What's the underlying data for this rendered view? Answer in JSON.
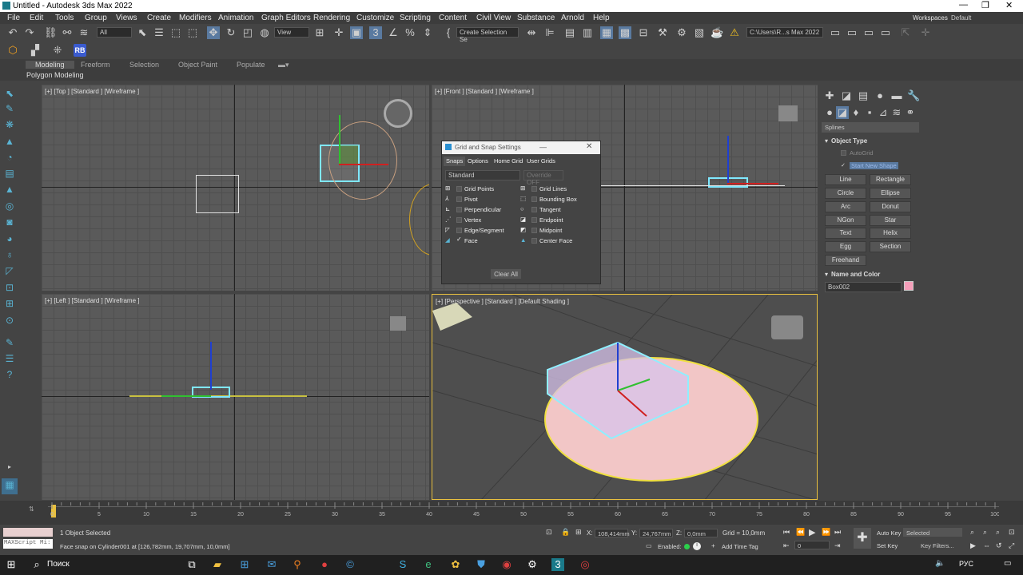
{
  "window": {
    "title": "Untitled - Autodesk 3ds Max 2022"
  },
  "menu": [
    "File",
    "Edit",
    "Tools",
    "Group",
    "Views",
    "Create",
    "Modifiers",
    "Animation",
    "Graph Editors",
    "Rendering",
    "Customize",
    "Scripting",
    "Content",
    "Civil View",
    "Substance",
    "Arnold",
    "Help"
  ],
  "workspaces": {
    "label": "Workspaces:",
    "value": "Default"
  },
  "toolbar": {
    "filter_value": "All",
    "view_value": "View",
    "selection_set_placeholder": "Create Selection Se",
    "path_value": "C:\\Users\\R...s Max 2022",
    "rb_label": "RB"
  },
  "ribbon": {
    "tabs": [
      "Modeling",
      "Freeform",
      "Selection",
      "Object Paint",
      "Populate"
    ],
    "subtab": "Polygon Modeling"
  },
  "viewports": {
    "top": "[+] [Top ] [Standard ] [Wireframe ]",
    "front": "[+] [Front ] [Standard ] [Wireframe ]",
    "left": "[+] [Left ] [Standard ] [Wireframe ]",
    "perspective": "[+] [Perspective ] [Standard ] [Default Shading ]"
  },
  "dialog": {
    "title": "Grid and Snap Settings",
    "tabs": [
      "Snaps",
      "Options",
      "Home Grid",
      "User Grids"
    ],
    "dropdown": "Standard",
    "override": "Override OFF",
    "snaps_left": [
      {
        "label": "Grid Points",
        "checked": false
      },
      {
        "label": "Pivot",
        "checked": false
      },
      {
        "label": "Perpendicular",
        "checked": false
      },
      {
        "label": "Vertex",
        "checked": false
      },
      {
        "label": "Edge/Segment",
        "checked": false
      },
      {
        "label": "Face",
        "checked": true
      }
    ],
    "snaps_right": [
      {
        "label": "Grid Lines",
        "checked": false
      },
      {
        "label": "Bounding Box",
        "checked": false
      },
      {
        "label": "Tangent",
        "checked": false
      },
      {
        "label": "Endpoint",
        "checked": false
      },
      {
        "label": "Midpoint",
        "checked": false
      },
      {
        "label": "Center Face",
        "checked": false
      }
    ],
    "clear_all": "Clear All"
  },
  "command_panel": {
    "category": "Splines",
    "object_type_header": "Object Type",
    "autogrid": "AutoGrid",
    "start_new_shape": "Start New Shape",
    "buttons": [
      "Line",
      "Rectangle",
      "Circle",
      "Ellipse",
      "Arc",
      "Donut",
      "NGon",
      "Star",
      "Text",
      "Helix",
      "Egg",
      "Section",
      "Freehand"
    ],
    "name_color_header": "Name and Color",
    "object_name": "Box002",
    "object_color": "#f59fba"
  },
  "timeline": {
    "frame_counter": "0 / 100",
    "ticks": [
      "0",
      "5",
      "10",
      "15",
      "20",
      "25",
      "30",
      "35",
      "40",
      "45",
      "50",
      "55",
      "60",
      "65",
      "70",
      "75",
      "80",
      "85",
      "90",
      "95",
      "100"
    ]
  },
  "status": {
    "maxscript": "MAXScript Mi:",
    "selected": "1 Object Selected",
    "message": "Face snap on Cylinder001 at [126,782mm, 19,707mm, 10,0mm]",
    "x_label": "X:",
    "x_value": "108,414mm",
    "y_label": "Y:",
    "y_value": "24,767mm",
    "z_label": "Z:",
    "z_value": "0,0mm",
    "grid": "Grid = 10,0mm",
    "enabled": "Enabled:",
    "add_time_tag": "Add Time Tag",
    "auto_key": "Auto Key",
    "selected_dropdown": "Selected",
    "set_key": "Set Key",
    "key_filters": "Key Filters...",
    "frame_value": "0"
  },
  "taskbar": {
    "search_placeholder": "Поиск",
    "lang": "РУС"
  }
}
